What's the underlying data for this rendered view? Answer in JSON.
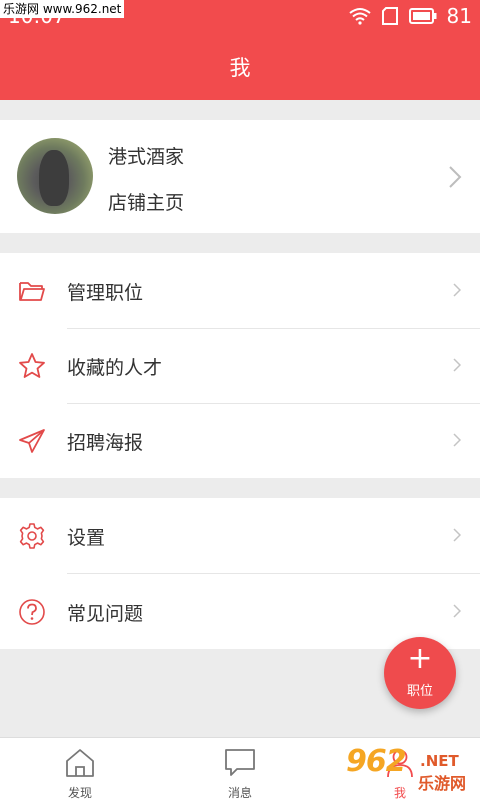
{
  "status_bar": {
    "time": "10:07",
    "battery": "81",
    "watermark": "乐游网 www.962.net"
  },
  "header": {
    "title": "我"
  },
  "profile": {
    "name": "港式酒家",
    "link_label": "店铺主页"
  },
  "menu": {
    "group1": [
      {
        "label": "管理职位",
        "icon": "folder-icon"
      },
      {
        "label": "收藏的人才",
        "icon": "star-icon"
      },
      {
        "label": "招聘海报",
        "icon": "paper-plane-icon"
      }
    ],
    "group2": [
      {
        "label": "设置",
        "icon": "gear-icon"
      },
      {
        "label": "常见问题",
        "icon": "question-icon"
      }
    ]
  },
  "fab": {
    "plus": "+",
    "label": "职位"
  },
  "tabbar": {
    "tabs": [
      {
        "label": "发现",
        "icon": "home-icon"
      },
      {
        "label": "消息",
        "icon": "message-icon"
      },
      {
        "label": "我",
        "icon": "person-icon"
      }
    ]
  },
  "watermark_br": {
    "number": "962",
    "net": ".NET",
    "cn": "乐游网"
  },
  "colors": {
    "accent": "#f24b4d",
    "background": "#ececec",
    "text": "#333333"
  }
}
